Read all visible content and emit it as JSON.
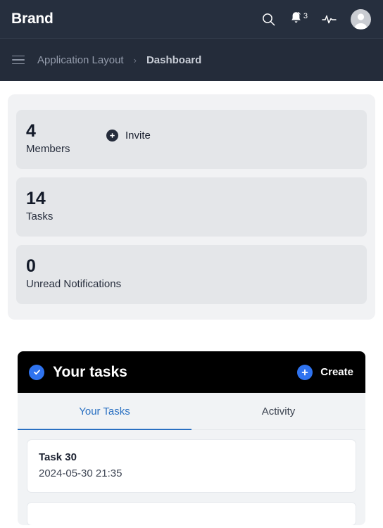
{
  "navbar": {
    "brand": "Brand",
    "icons": {
      "search": "search-icon",
      "bell": "bell-icon",
      "activity": "activity-pulse-icon",
      "avatar": "user-avatar-icon"
    },
    "notification_count": "3"
  },
  "breadcrumb": {
    "menu_icon": "hamburger-menu-icon",
    "parent": "Application Layout",
    "separator": "›",
    "current": "Dashboard"
  },
  "stats": {
    "cards": [
      {
        "value": "4",
        "label": "Members"
      },
      {
        "value": "14",
        "label": "Tasks"
      },
      {
        "value": "0",
        "label": "Unread Notifications"
      }
    ],
    "invite_label": "Invite",
    "invite_icon": "plus-circle-icon"
  },
  "tasks_panel": {
    "title": "Your tasks",
    "title_icon": "check-circle-icon",
    "create_label": "Create",
    "create_icon": "plus-circle-icon",
    "tabs": [
      {
        "label": "Your Tasks",
        "active": true
      },
      {
        "label": "Activity",
        "active": false
      }
    ],
    "items": [
      {
        "name": "Task 30",
        "date": "2024-05-30 21:35"
      },
      {
        "name": "",
        "date": ""
      }
    ]
  },
  "colors": {
    "navbar_bg": "#262f3e",
    "breadcrumb_bg": "#242c3a",
    "panel_bg": "#f1f2f4",
    "stat_card_bg": "#e4e6e9",
    "accent_blue": "#2f73ef",
    "tab_active": "#2a70c2",
    "header_black": "#000000"
  }
}
